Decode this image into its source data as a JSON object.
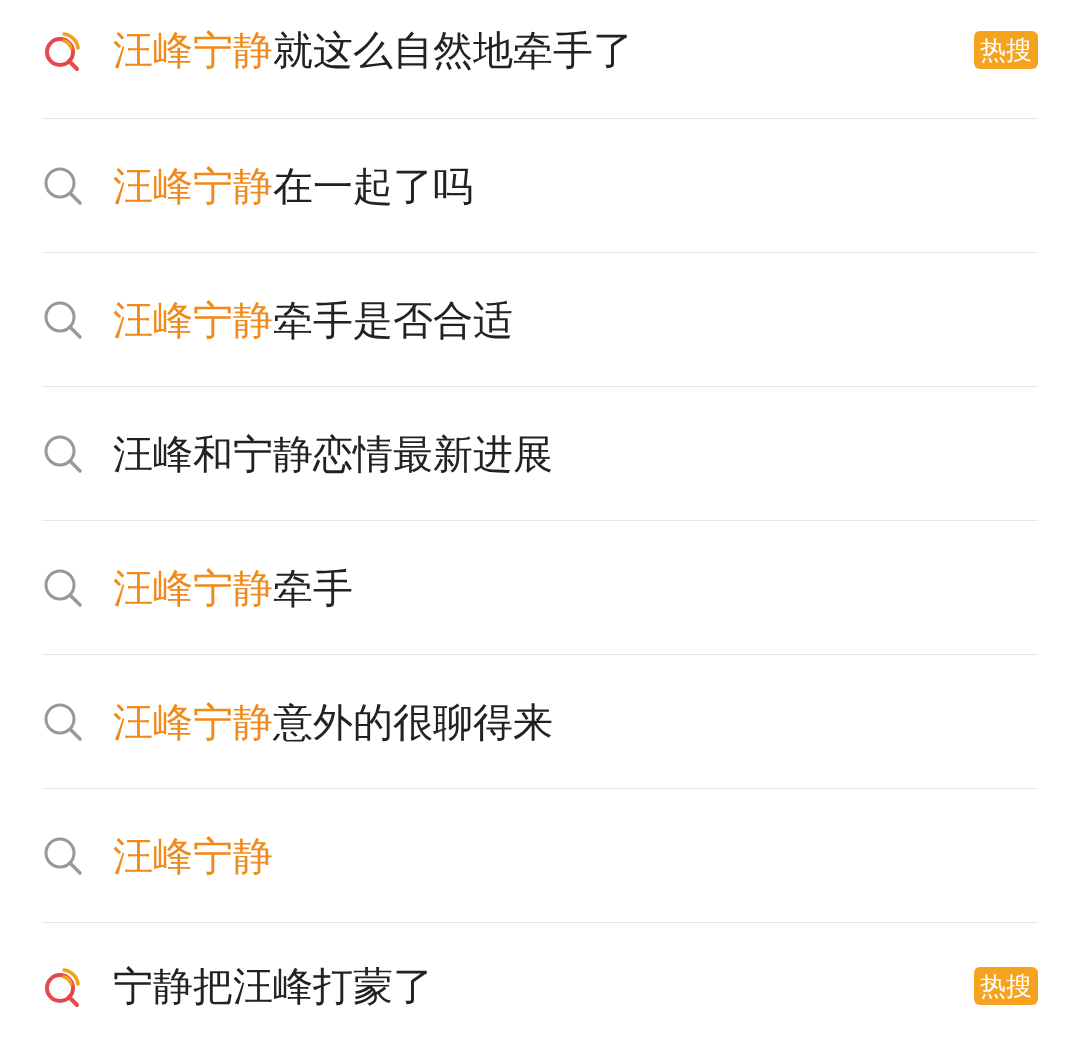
{
  "suggestions": [
    {
      "kind": "hot",
      "highlight": "汪峰宁静",
      "rest": "就这么自然地牵手了",
      "badge": "热搜"
    },
    {
      "kind": "normal",
      "highlight": "汪峰宁静",
      "rest": "在一起了吗"
    },
    {
      "kind": "normal",
      "highlight": "汪峰宁静",
      "rest": "牵手是否合适"
    },
    {
      "kind": "normal",
      "rest": "汪峰和宁静恋情最新进展"
    },
    {
      "kind": "normal",
      "highlight": "汪峰宁静",
      "rest": "牵手"
    },
    {
      "kind": "normal",
      "highlight": "汪峰宁静",
      "rest": "意外的很聊得来"
    },
    {
      "kind": "normal",
      "highlight": "汪峰宁静"
    },
    {
      "kind": "hot",
      "rest": "宁静把汪峰打蒙了",
      "badge": "热搜"
    }
  ]
}
